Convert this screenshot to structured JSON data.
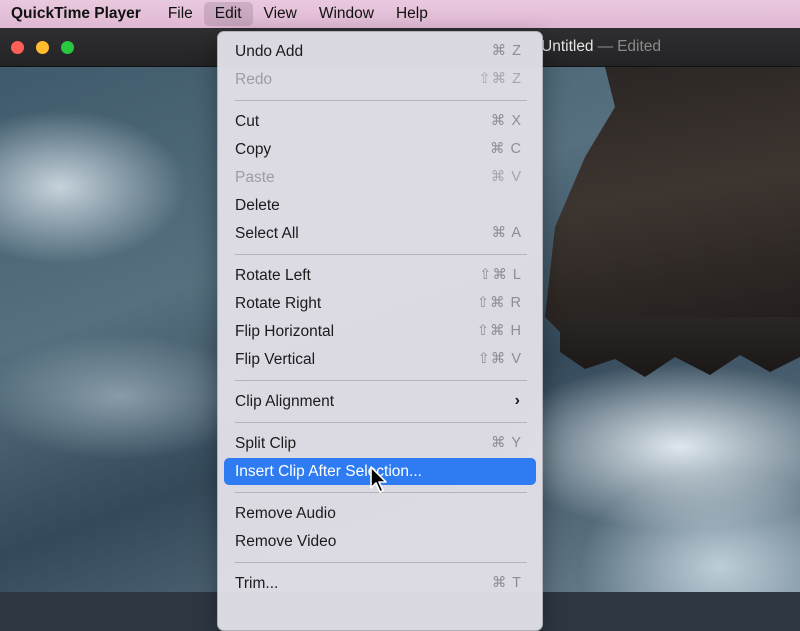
{
  "menubar": {
    "app_name": "QuickTime Player",
    "items": [
      "File",
      "Edit",
      "View",
      "Window",
      "Help"
    ]
  },
  "window": {
    "title": "Untitled",
    "title_separator": "—",
    "title_status": "Edited"
  },
  "edit_menu": {
    "items": [
      {
        "label": "Undo Add",
        "shortcut": "⌘ Z",
        "enabled": true
      },
      {
        "label": "Redo",
        "shortcut": "⇧⌘ Z",
        "enabled": false
      },
      {
        "label": "Cut",
        "shortcut": "⌘ X",
        "enabled": true
      },
      {
        "label": "Copy",
        "shortcut": "⌘ C",
        "enabled": true
      },
      {
        "label": "Paste",
        "shortcut": "⌘ V",
        "enabled": false
      },
      {
        "label": "Delete",
        "shortcut": "",
        "enabled": true
      },
      {
        "label": "Select All",
        "shortcut": "⌘ A",
        "enabled": true
      },
      {
        "label": "Rotate Left",
        "shortcut": "⇧⌘ L",
        "enabled": true
      },
      {
        "label": "Rotate Right",
        "shortcut": "⇧⌘ R",
        "enabled": true
      },
      {
        "label": "Flip Horizontal",
        "shortcut": "⇧⌘ H",
        "enabled": true
      },
      {
        "label": "Flip Vertical",
        "shortcut": "⇧⌘ V",
        "enabled": true
      },
      {
        "label": "Clip Alignment",
        "shortcut": "",
        "enabled": true,
        "submenu": true
      },
      {
        "label": "Split Clip",
        "shortcut": "⌘ Y",
        "enabled": true
      },
      {
        "label": "Insert Clip After Selection...",
        "shortcut": "",
        "enabled": true,
        "highlighted": true
      },
      {
        "label": "Remove Audio",
        "shortcut": "",
        "enabled": true
      },
      {
        "label": "Remove Video",
        "shortcut": "",
        "enabled": true
      },
      {
        "label": "Trim...",
        "shortcut": "⌘ T",
        "enabled": true
      }
    ],
    "submenu_icon": "chevron-right-icon"
  },
  "colors": {
    "highlight": "#2f7bf2",
    "menubar": "#e2bfd7",
    "traffic_red": "#ff5f57",
    "traffic_yellow": "#febc2e",
    "traffic_green": "#28c840"
  },
  "cursor_icon": "arrow-pointer-icon"
}
